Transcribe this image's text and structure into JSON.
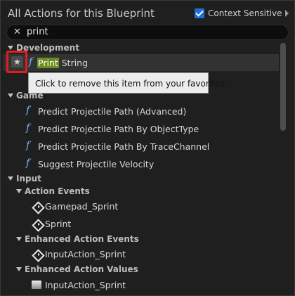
{
  "header": {
    "title": "All Actions for this Blueprint",
    "context_sensitive_label": "Context Sensitive",
    "context_sensitive_checked": true
  },
  "search": {
    "value": "print",
    "clear_icon": "close-icon"
  },
  "categories": {
    "development": "Development",
    "game": "Game",
    "input": "Input",
    "action_events": "Action Events",
    "enhanced_action_events": "Enhanced Action Events",
    "enhanced_action_values": "Enhanced Action Values"
  },
  "items": {
    "print_string_match": "Print",
    "print_string_rest": " String",
    "predict_adv": "Predict Projectile Path (Advanced)",
    "predict_obj": "Predict Projectile Path By ObjectType",
    "predict_trace": "Predict Projectile Path By TraceChannel",
    "suggest_velocity": "Suggest Projectile Velocity",
    "gamepad_sprint": "Gamepad_Sprint",
    "sprint": "Sprint",
    "input_action_sprint_event": "InputAction_Sprint",
    "input_action_sprint_value": "InputAction_Sprint"
  },
  "tooltip": {
    "text": "Click to remove this item from your favorites."
  },
  "colors": {
    "highlight": "#6b8c1f",
    "favorite_outline": "#e11d1d",
    "function_icon": "#7fb2ff",
    "checkbox": "#1e6fd9"
  }
}
